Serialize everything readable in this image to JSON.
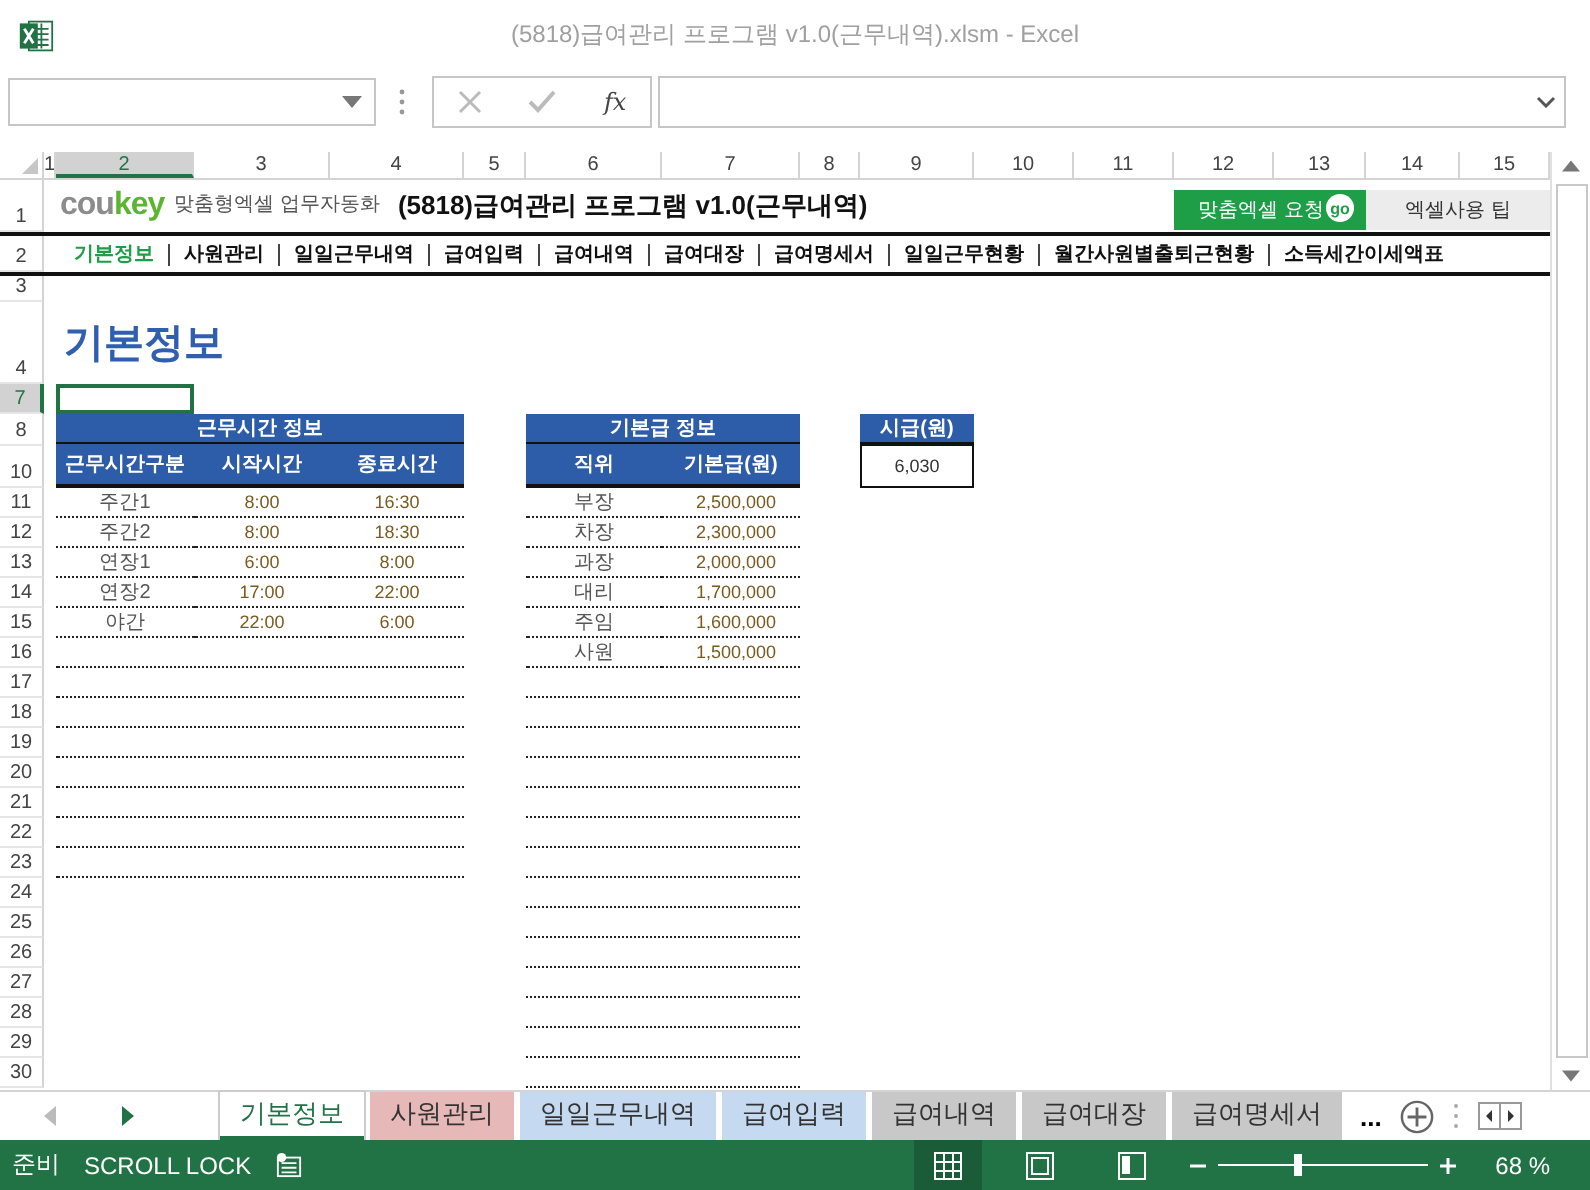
{
  "window": {
    "title": "(5818)급여관리 프로그램 v1.0(근무내역).xlsm - Excel"
  },
  "formula_bar": {
    "fx_label": "fx"
  },
  "column_headers": [
    {
      "label": "1",
      "selected": false
    },
    {
      "label": "2",
      "selected": true
    },
    {
      "label": "3",
      "selected": false
    },
    {
      "label": "4",
      "selected": false
    },
    {
      "label": "5",
      "selected": false
    },
    {
      "label": "6",
      "selected": false
    },
    {
      "label": "7",
      "selected": false
    },
    {
      "label": "8",
      "selected": false
    },
    {
      "label": "9",
      "selected": false
    },
    {
      "label": "10",
      "selected": false
    },
    {
      "label": "11",
      "selected": false
    },
    {
      "label": "12",
      "selected": false
    },
    {
      "label": "13",
      "selected": false
    },
    {
      "label": "14",
      "selected": false
    },
    {
      "label": "15",
      "selected": false
    }
  ],
  "row_headers": [
    {
      "label": "1",
      "selected": false
    },
    {
      "label": "2",
      "selected": false
    },
    {
      "label": "3",
      "selected": false
    },
    {
      "label": "4",
      "selected": false
    },
    {
      "label": "7",
      "selected": true
    },
    {
      "label": "8",
      "selected": false
    },
    {
      "label": "10",
      "selected": false
    },
    {
      "label": "11",
      "selected": false
    },
    {
      "label": "12",
      "selected": false
    },
    {
      "label": "13",
      "selected": false
    },
    {
      "label": "14",
      "selected": false
    },
    {
      "label": "15",
      "selected": false
    },
    {
      "label": "16",
      "selected": false
    },
    {
      "label": "17",
      "selected": false
    },
    {
      "label": "18",
      "selected": false
    },
    {
      "label": "19",
      "selected": false
    },
    {
      "label": "20",
      "selected": false
    },
    {
      "label": "21",
      "selected": false
    },
    {
      "label": "22",
      "selected": false
    },
    {
      "label": "23",
      "selected": false
    },
    {
      "label": "24",
      "selected": false
    },
    {
      "label": "25",
      "selected": false
    },
    {
      "label": "26",
      "selected": false
    },
    {
      "label": "27",
      "selected": false
    },
    {
      "label": "28",
      "selected": false
    },
    {
      "label": "29",
      "selected": false
    },
    {
      "label": "30",
      "selected": false
    }
  ],
  "header": {
    "logo_gray": "cou",
    "logo_green": "key",
    "tagline": "맞춤형엑셀 업무자동화",
    "title": "(5818)급여관리 프로그램 v1.0(근무내역)",
    "request_button": "맞춤엑셀 요청",
    "go_badge": "go",
    "tips_button": "엑셀사용 팁"
  },
  "nav": [
    {
      "label": "기본정보",
      "selected": true
    },
    {
      "label": "사원관리",
      "selected": false
    },
    {
      "label": "일일근무내역",
      "selected": false
    },
    {
      "label": "급여입력",
      "selected": false
    },
    {
      "label": "급여내역",
      "selected": false
    },
    {
      "label": "급여대장",
      "selected": false
    },
    {
      "label": "급여명세서",
      "selected": false
    },
    {
      "label": "일일근무현황",
      "selected": false
    },
    {
      "label": "월간사원별출퇴근현황",
      "selected": false
    },
    {
      "label": "소득세간이세액표",
      "selected": false
    }
  ],
  "page_heading": "기본정보",
  "work_time_table": {
    "title": "근무시간 정보",
    "columns": [
      "근무시간구분",
      "시작시간",
      "종료시간"
    ],
    "rows": [
      {
        "type": "주간1",
        "start": "8:00",
        "end": "16:30"
      },
      {
        "type": "주간2",
        "start": "8:00",
        "end": "18:30"
      },
      {
        "type": "연장1",
        "start": "6:00",
        "end": "8:00"
      },
      {
        "type": "연장2",
        "start": "17:00",
        "end": "22:00"
      },
      {
        "type": "야간",
        "start": "22:00",
        "end": "6:00"
      }
    ]
  },
  "base_pay_table": {
    "title": "기본급 정보",
    "columns": [
      "직위",
      "기본급(원)"
    ],
    "rows": [
      {
        "position": "부장",
        "pay": "2,500,000"
      },
      {
        "position": "차장",
        "pay": "2,300,000"
      },
      {
        "position": "과장",
        "pay": "2,000,000"
      },
      {
        "position": "대리",
        "pay": "1,700,000"
      },
      {
        "position": "주임",
        "pay": "1,600,000"
      },
      {
        "position": "사원",
        "pay": "1,500,000"
      }
    ]
  },
  "hourly_wage": {
    "label": "시급(원)",
    "value": "6,030"
  },
  "sheet_tabs": [
    {
      "label": "기본정보",
      "selected": true,
      "color": "#ffffff"
    },
    {
      "label": "사원관리",
      "selected": false,
      "color": "#e6b8b7"
    },
    {
      "label": "일일근무내역",
      "selected": false,
      "color": "#c5d9f1"
    },
    {
      "label": "급여입력",
      "selected": false,
      "color": "#c5d9f1"
    },
    {
      "label": "급여내역",
      "selected": false,
      "color": "#c8c8c8"
    },
    {
      "label": "급여대장",
      "selected": false,
      "color": "#c8c8c8"
    },
    {
      "label": "급여명세서",
      "selected": false,
      "color": "#c8c8c8"
    }
  ],
  "more_tabs": "...",
  "status_bar": {
    "mode": "준비",
    "scroll_lock": "SCROLL LOCK",
    "zoom": {
      "level": 0.38
    },
    "zoom_text": "68 %"
  }
}
